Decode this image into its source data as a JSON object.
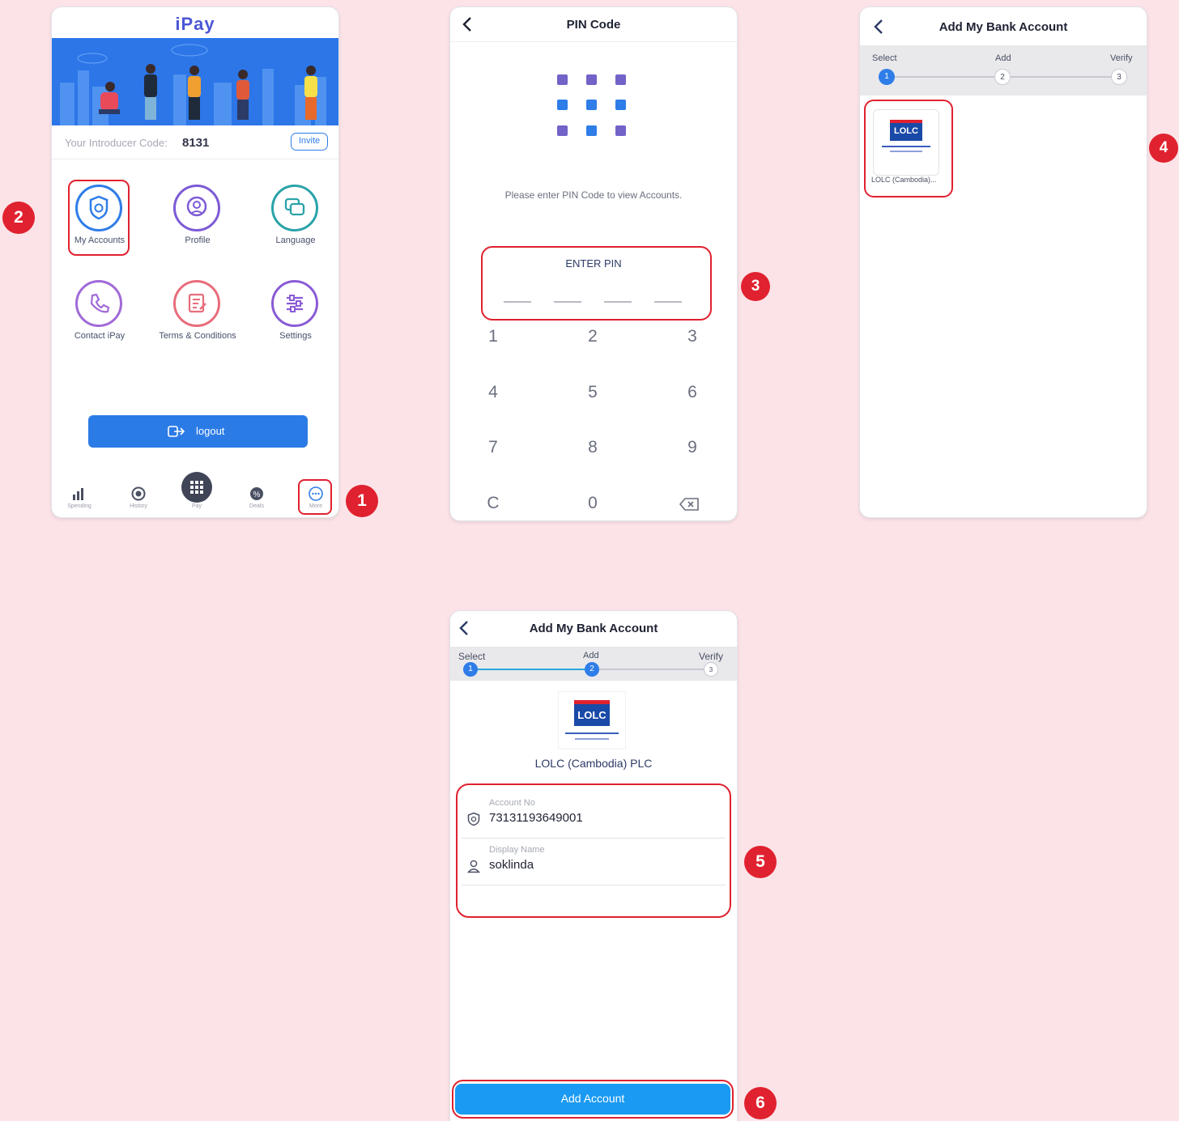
{
  "badges": [
    "1",
    "2",
    "3",
    "4",
    "5",
    "6"
  ],
  "screen1": {
    "app_title": "iPay",
    "introducer_label": "Your Introducer Code:",
    "introducer_code": "8131",
    "invite_label": "Invite",
    "menu": [
      "My Accounts",
      "Profile",
      "Language",
      "Contact iPay",
      "Terms & Conditions",
      "Settings"
    ],
    "logout_label": "logout",
    "nav": [
      "Spending",
      "History",
      "Pay",
      "Deals",
      "More"
    ]
  },
  "screen2": {
    "title": "PIN Code",
    "prompt": "Please enter PIN Code to view Accounts.",
    "enter_pin": "ENTER PIN",
    "keys": [
      "1",
      "2",
      "3",
      "4",
      "5",
      "6",
      "7",
      "8",
      "9",
      "C",
      "0"
    ]
  },
  "screen3": {
    "title": "Add My Bank Account",
    "steps": [
      "Select",
      "Add",
      "Verify"
    ],
    "step_nums": [
      "1",
      "2",
      "3"
    ],
    "bank_short": "LOLC (Cambodia)..."
  },
  "screen4": {
    "title": "Add My Bank Account",
    "steps": [
      "Select",
      "Add",
      "Verify"
    ],
    "step_nums": [
      "1",
      "2",
      "3"
    ],
    "bank_name": "LOLC (Cambodia) PLC",
    "account_label": "Account No",
    "account_value": "73131193649001",
    "display_label": "Display Name",
    "display_value": "soklinda",
    "add_button": "Add Account"
  },
  "logo_text": "LOLC",
  "colors": {
    "accent": "#2f7de8",
    "red": "#e0212f",
    "purple": "#7e5bd6",
    "teal": "#2aa3a8",
    "pink": "#e86d7c"
  }
}
